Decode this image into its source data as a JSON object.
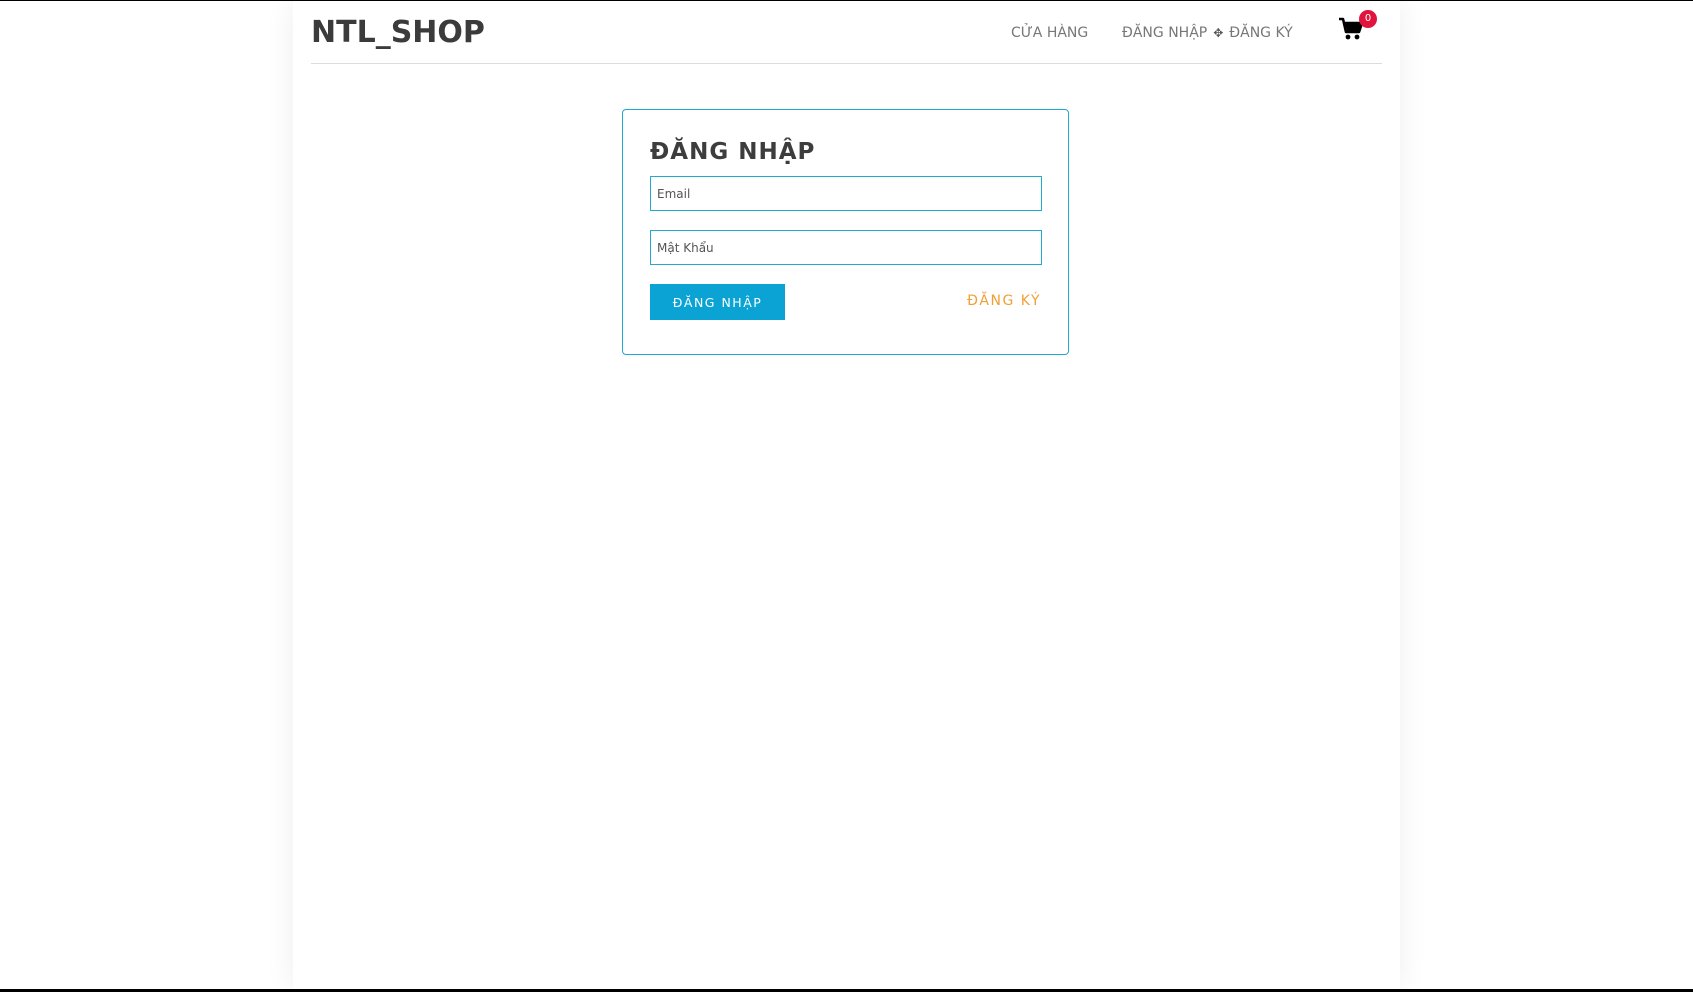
{
  "header": {
    "brand": "NTL_SHOP",
    "nav_store": "CỬA HÀNG",
    "nav_login": "ĐĂNG NHẬP",
    "nav_register": "ĐĂNG KÝ",
    "separator_icon": "arrows-move-icon",
    "cart_icon": "shopping-cart-icon",
    "cart_count": "0"
  },
  "login_form": {
    "title": "ĐĂNG NHẬP",
    "email_placeholder": "Email",
    "password_placeholder": "Mật Khẩu",
    "submit_label": "ĐĂNG NHẬP",
    "register_link": "ĐĂNG KÝ"
  },
  "colors": {
    "accent": "#21a9cf",
    "button": "#0aa3d4",
    "register_link": "#f0a035",
    "cart_badge": "#e0143c"
  }
}
